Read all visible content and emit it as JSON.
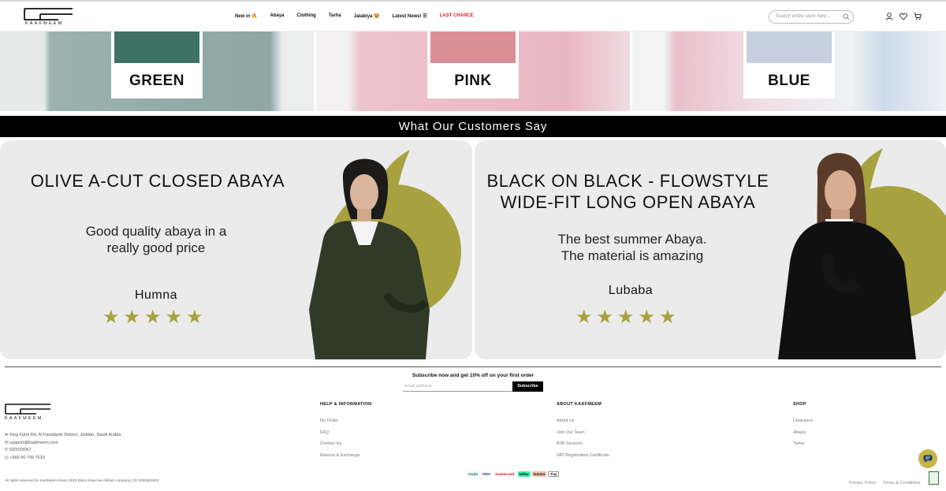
{
  "brand": {
    "name": "KAAFMEEM"
  },
  "nav": {
    "items": [
      "New in 🔥",
      "Abaya",
      "Clothing",
      "Tarha",
      "Jalabiya 🤩",
      "Latest News! ☰",
      "LAST CHANCE"
    ]
  },
  "search": {
    "placeholder": "Search entire store here..."
  },
  "header_icons": [
    "user-icon",
    "heart-icon",
    "cart-icon"
  ],
  "color_tiles": [
    {
      "label": "GREEN",
      "swatch": "#3f7267"
    },
    {
      "label": "PINK",
      "swatch": "#dc8e97"
    },
    {
      "label": "BLUE",
      "swatch": "#c6cfdd"
    }
  ],
  "testimonials_heading": "What Our Customers Say",
  "testimonials": [
    {
      "product": "OLIVE A-CUT CLOSED ABAYA",
      "quote_line1": "Good quality abaya in a",
      "quote_line2": "really good price",
      "author": "Humna",
      "rating": 5
    },
    {
      "product_line1": "BLACK ON BLACK - FLOWSTYLE",
      "product_line2": "WIDE-FIT LONG OPEN ABAYA",
      "quote_line1": "The best summer Abaya.",
      "quote_line2": "The material is amazing",
      "author": "Lubaba",
      "rating": 5
    }
  ],
  "subscribe": {
    "title": "Subscribe now and get 10% off on your first order",
    "placeholder": "email address",
    "button": "Subscribe"
  },
  "contact": {
    "address": "King Fahd Rd, Al Faisaliyah District, Jeddah, Saudi Arabia",
    "email": "support@kaafmeem.com",
    "phone1": "920033067",
    "whatsapp": "+966 56 706 7010"
  },
  "footer": {
    "help": {
      "title": "HELP & INFORMATION",
      "links": [
        "My Order",
        "FAQ",
        "Contact Us",
        "Returns & Exchange"
      ]
    },
    "about": {
      "title": "ABOUT KAAFMEEM",
      "links": [
        "About Us",
        "Join Our Team",
        "B2B Services",
        "VAT Registration Certificate"
      ]
    },
    "shop": {
      "title": "SHOP",
      "links": [
        "Clearance",
        "Abaya",
        "Tarha"
      ]
    },
    "copyright": "All rights reserved for KaafMeem brand 2025 (Mira Alsaid wa Alkhair company) CR 4030381903",
    "payments": [
      "mada",
      "VISA",
      "mastercard",
      "tabby",
      "tamara",
      "Pay"
    ],
    "legal": [
      "Privacy Policy",
      "Terms & Conditions"
    ]
  },
  "colors": {
    "accent": "#a7a140",
    "sale": "#d62424",
    "banner": "#000000"
  }
}
